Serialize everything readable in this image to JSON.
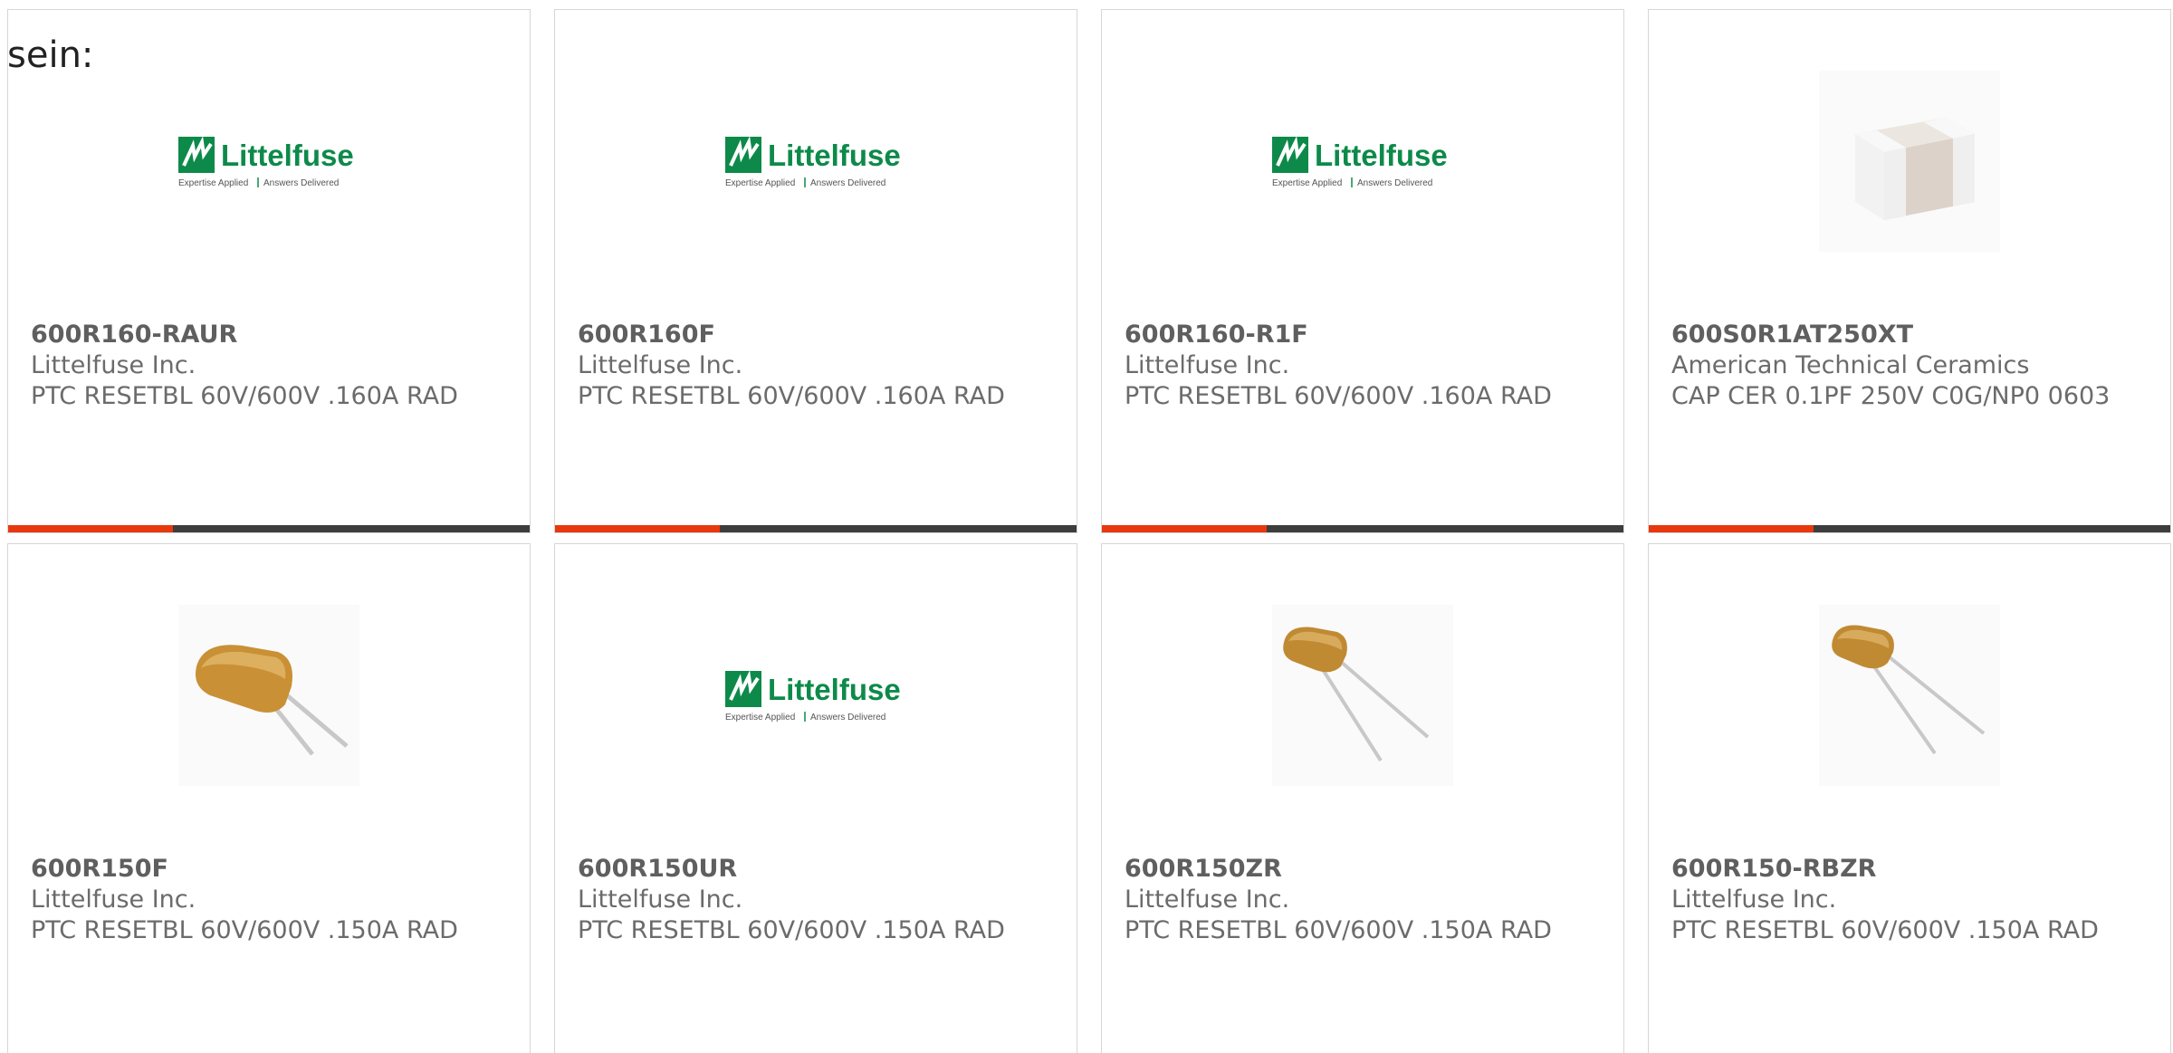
{
  "intro": {
    "text": "sein:"
  },
  "colors": {
    "accent": "#e8380d",
    "bar": "#3d3d3d",
    "brand_green": "#0d8a4a"
  },
  "products": [
    {
      "part": "600R160-RAUR",
      "manufacturer": "Littelfuse Inc.",
      "description": "PTC RESETBL 60V/600V .160A RAD",
      "image": "littelfuse-logo",
      "logo": {
        "name": "Littelfuse",
        "tagline_left": "Expertise Applied",
        "tagline_right": "Answers Delivered"
      }
    },
    {
      "part": "600R160F",
      "manufacturer": "Littelfuse Inc.",
      "description": "PTC RESETBL 60V/600V .160A RAD",
      "image": "littelfuse-logo",
      "logo": {
        "name": "Littelfuse",
        "tagline_left": "Expertise Applied",
        "tagline_right": "Answers Delivered"
      }
    },
    {
      "part": "600R160-R1F",
      "manufacturer": "Littelfuse Inc.",
      "description": "PTC RESETBL 60V/600V .160A RAD",
      "image": "littelfuse-logo",
      "logo": {
        "name": "Littelfuse",
        "tagline_left": "Expertise Applied",
        "tagline_right": "Answers Delivered"
      }
    },
    {
      "part": "600S0R1AT250XT",
      "manufacturer": "American Technical Ceramics",
      "description": "CAP CER 0.1PF 250V C0G/NP0 0603",
      "image": "smd-capacitor-photo"
    },
    {
      "part": "600R150F",
      "manufacturer": "Littelfuse Inc.",
      "description": "PTC RESETBL 60V/600V .150A RAD",
      "image": "radial-ptc-large-photo"
    },
    {
      "part": "600R150UR",
      "manufacturer": "Littelfuse Inc.",
      "description": "PTC RESETBL 60V/600V .150A RAD",
      "image": "littelfuse-logo",
      "logo": {
        "name": "Littelfuse",
        "tagline_left": "Expertise Applied",
        "tagline_right": "Answers Delivered"
      }
    },
    {
      "part": "600R150ZR",
      "manufacturer": "Littelfuse Inc.",
      "description": "PTC RESETBL 60V/600V .150A RAD",
      "image": "radial-ptc-small-photo"
    },
    {
      "part": "600R150-RBZR",
      "manufacturer": "Littelfuse Inc.",
      "description": "PTC RESETBL 60V/600V .150A RAD",
      "image": "radial-ptc-small-photo"
    }
  ]
}
